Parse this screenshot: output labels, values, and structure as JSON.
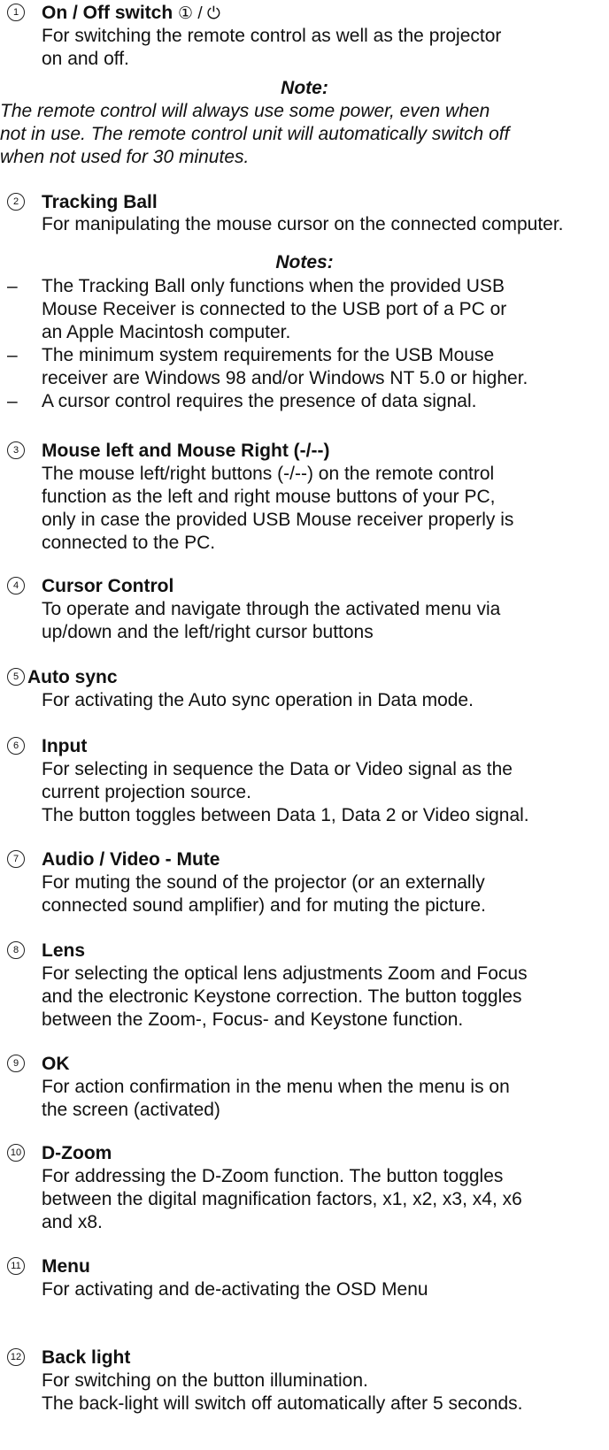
{
  "sections": {
    "s1": {
      "num": "1",
      "title": "On / Off switch",
      "title_symbols": "① / ⏻",
      "lines": [
        "For switching the remote control as well as the projector",
        "on and off."
      ],
      "note_heading": "Note:",
      "note_lines": [
        "The remote control will always use some power, even when",
        "not in use. The remote control unit will automatically switch off",
        "when not used for 30 minutes."
      ]
    },
    "s2": {
      "num": "2",
      "title": "Tracking Ball",
      "lines": [
        "For manipulating the mouse cursor on the connected computer."
      ],
      "notes_heading": "Notes:",
      "bullets": [
        [
          "The Tracking Ball only functions when the provided USB",
          "Mouse Receiver is connected to the USB port of a PC or",
          "an Apple Macintosh computer."
        ],
        [
          "The minimum system requirements for the USB Mouse",
          "receiver are Windows 98 and/or Windows NT 5.0 or higher."
        ],
        [
          "A cursor control requires the presence of data signal."
        ]
      ]
    },
    "s3": {
      "num": "3",
      "title": "Mouse left and Mouse Right (-/--)",
      "lines": [
        "The mouse left/right buttons (-/--) on the remote control",
        "function as the left and right mouse buttons of your PC,",
        "only in case the provided USB Mouse receiver properly is",
        "connected to the PC."
      ]
    },
    "s4": {
      "num": "4",
      "title": "Cursor Control",
      "lines": [
        "To operate and navigate through the activated menu via",
        "up/down and the left/right cursor buttons"
      ]
    },
    "s5": {
      "num": "5",
      "title": "Auto sync",
      "lines": [
        "For activating the Auto sync operation in Data mode."
      ]
    },
    "s6": {
      "num": "6",
      "title": "Input",
      "lines": [
        "For selecting in sequence the Data or Video signal as the",
        "current projection source.",
        "The button toggles between Data 1, Data 2 or Video signal."
      ]
    },
    "s7": {
      "num": "7",
      "title": "Audio / Video - Mute",
      "lines": [
        "For muting the sound of the projector (or an externally",
        "connected sound amplifier) and for muting the picture."
      ]
    },
    "s8": {
      "num": "8",
      "title": "Lens",
      "lines": [
        "For selecting the optical lens adjustments Zoom and Focus",
        "and the electronic Keystone correction. The button toggles",
        "between the Zoom-, Focus- and Keystone function."
      ]
    },
    "s9": {
      "num": "9",
      "title": "OK",
      "lines": [
        "For action confirmation in the menu when the menu is on",
        "the screen (activated)"
      ]
    },
    "s10": {
      "num": "10",
      "title": "D-Zoom",
      "lines": [
        "For addressing the D-Zoom function. The button toggles",
        "between the digital magnification factors, x1, x2, x3, x4, x6",
        "and x8."
      ]
    },
    "s11": {
      "num": "11",
      "title": "Menu",
      "lines": [
        "For activating and de-activating the OSD Menu"
      ]
    },
    "s12": {
      "num": "12",
      "title": "Back light",
      "lines": [
        "For switching on the button illumination.",
        "The back-light will switch off automatically after 5 seconds."
      ]
    }
  },
  "dash": "–"
}
